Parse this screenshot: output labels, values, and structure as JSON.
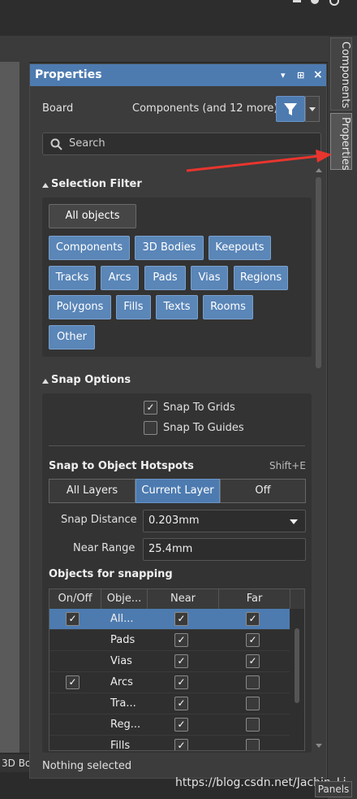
{
  "panel": {
    "title": "Properties",
    "ctl_menu": "▾",
    "ctl_pin": "⊞",
    "ctl_close": "×"
  },
  "side_tabs": {
    "components": "Components",
    "properties": "Properties"
  },
  "board": {
    "label": "Board",
    "components_summary": "Components (and 12 more)"
  },
  "search": {
    "placeholder": "Search"
  },
  "selection_filter": {
    "title": "Selection Filter",
    "all_objects": "All objects",
    "chips": [
      "Components",
      "3D Bodies",
      "Keepouts",
      "Tracks",
      "Arcs",
      "Pads",
      "Vias",
      "Regions",
      "Polygons",
      "Fills",
      "Texts",
      "Rooms",
      "Other"
    ]
  },
  "snap_options": {
    "title": "Snap Options",
    "snap_to_grids": "Snap To Grids",
    "snap_to_guides": "Snap To Guides",
    "hotspots_title": "Snap to Object Hotspots",
    "hotspots_shortcut": "Shift+E",
    "layers": [
      "All Layers",
      "Current Layer",
      "Off"
    ],
    "snap_distance_label": "Snap Distance",
    "snap_distance_value": "0.203mm",
    "near_range_label": "Near Range",
    "near_range_value": "25.4mm",
    "objects_title": "Objects for snapping",
    "columns": [
      "On/Off",
      "Obje...",
      "Near",
      "Far"
    ],
    "rows": [
      {
        "name": "All...",
        "on": true,
        "near": true,
        "far": true,
        "selected": true
      },
      {
        "name": "Pads",
        "on": false,
        "near": true,
        "far": true,
        "selected": false
      },
      {
        "name": "Vias",
        "on": false,
        "near": true,
        "far": true,
        "selected": false
      },
      {
        "name": "Arcs",
        "on": true,
        "near": true,
        "far": false,
        "selected": false
      },
      {
        "name": "Tra...",
        "on": false,
        "near": true,
        "far": false,
        "selected": false
      },
      {
        "name": "Reg...",
        "on": false,
        "near": true,
        "far": false,
        "selected": false
      },
      {
        "name": "Fills",
        "on": false,
        "near": true,
        "far": false,
        "selected": false
      }
    ]
  },
  "status": {
    "nothing_selected": "Nothing selected"
  },
  "bottom_tab": "3D Bc",
  "panels_button": "Panels",
  "watermark": "https://blog.csdn.net/Jachin_Li",
  "colors": {
    "accent": "#4d7bb0",
    "annotation_arrow": "#e8352e"
  }
}
